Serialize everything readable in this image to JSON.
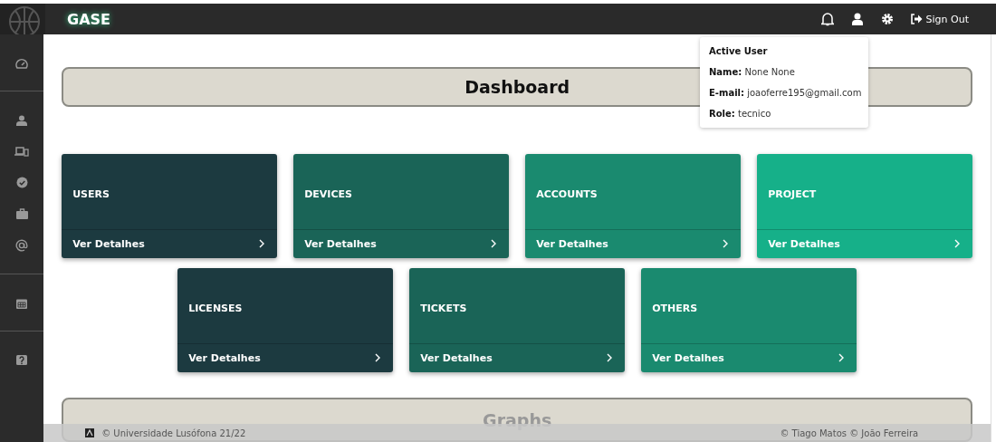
{
  "topbar": {
    "brand": "GASE",
    "sign_out": "Sign Out"
  },
  "user_popup": {
    "title": "Active User",
    "fields": [
      {
        "label": "Name:",
        "value": "None None"
      },
      {
        "label": "E-mail:",
        "value": "joaoferre195@gmail.com"
      },
      {
        "label": "Role:",
        "value": "tecnico"
      }
    ]
  },
  "sidebar": {
    "groups": [
      [
        {
          "kind": "dashboard"
        }
      ],
      [
        {
          "kind": "user"
        },
        {
          "kind": "devices"
        },
        {
          "kind": "badge"
        },
        {
          "kind": "briefcase"
        },
        {
          "kind": "at"
        }
      ],
      [
        {
          "kind": "calendar"
        }
      ],
      [
        {
          "kind": "help"
        }
      ]
    ]
  },
  "header": {
    "title": "Dashboard"
  },
  "cards": [
    [
      {
        "title": "USERS",
        "link": "Ver Detalhes",
        "color": "#1c3a40"
      },
      {
        "title": "DEVICES",
        "link": "Ver Detalhes",
        "color": "#1a6457"
      },
      {
        "title": "ACCOUNTS",
        "link": "Ver Detalhes",
        "color": "#1a8a6f"
      },
      {
        "title": "PROJECT",
        "link": "Ver Detalhes",
        "color": "#16b089"
      }
    ],
    [
      {
        "title": "LICENSES",
        "link": "Ver Detalhes",
        "color": "#1c3a40"
      },
      {
        "title": "TICKETS",
        "link": "Ver Detalhes",
        "color": "#1a6457"
      },
      {
        "title": "OTHERS",
        "link": "Ver Detalhes",
        "color": "#1a8a6f"
      }
    ]
  ],
  "graphs": {
    "title": "Graphs"
  },
  "footer": {
    "left": "© Universidade Lusófona 21/22",
    "right": "© Tiago Matos © João Ferreira"
  }
}
